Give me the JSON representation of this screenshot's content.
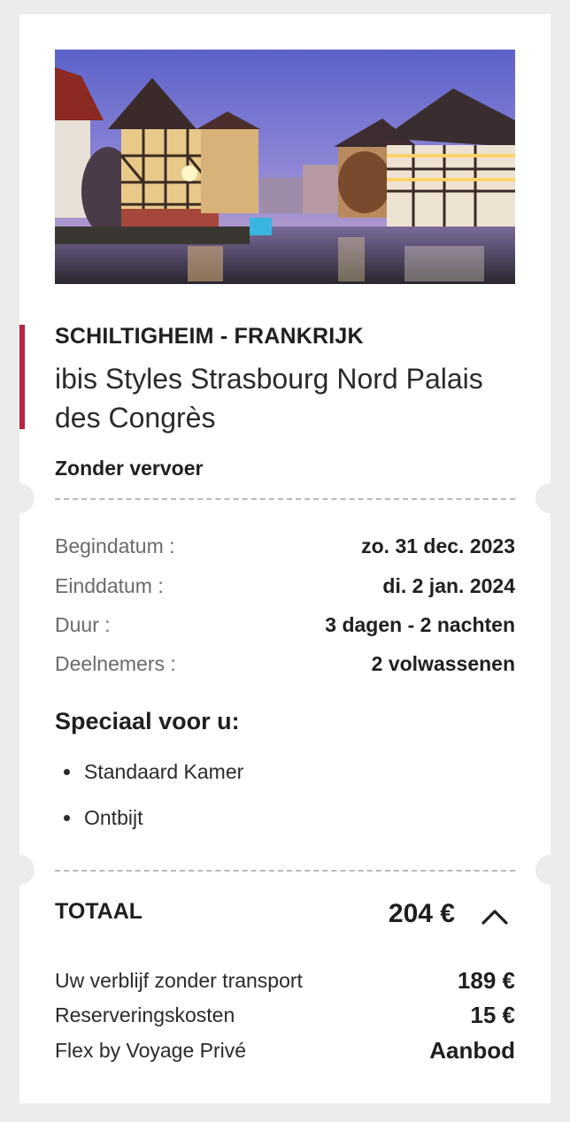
{
  "offer": {
    "location": "SCHILTIGHEIM - FRANKRIJK",
    "hotel_name": "ibis Styles Strasbourg Nord Palais des Congrès",
    "transport": "Zonder vervoer",
    "accent_color": "#b8233e"
  },
  "details": [
    {
      "label": "Begindatum :",
      "value": "zo. 31 dec. 2023"
    },
    {
      "label": "Einddatum :",
      "value": "di. 2 jan. 2024"
    },
    {
      "label": "Duur :",
      "value": "3 dagen - 2 nachten"
    },
    {
      "label": "Deelnemers :",
      "value": "2 volwassenen"
    }
  ],
  "special": {
    "title": "Speciaal voor u:",
    "items": [
      "Standaard Kamer",
      "Ontbijt"
    ]
  },
  "total": {
    "label": "TOTAAL",
    "amount": "204 €",
    "toggle_icon": "chevron-up-icon"
  },
  "breakdown": [
    {
      "label": "Uw verblijf zonder transport",
      "value": "189 €"
    },
    {
      "label": "Reserveringskosten",
      "value": "15 €"
    },
    {
      "label": "Flex by Voyage Privé",
      "value": "Aanbod"
    }
  ]
}
